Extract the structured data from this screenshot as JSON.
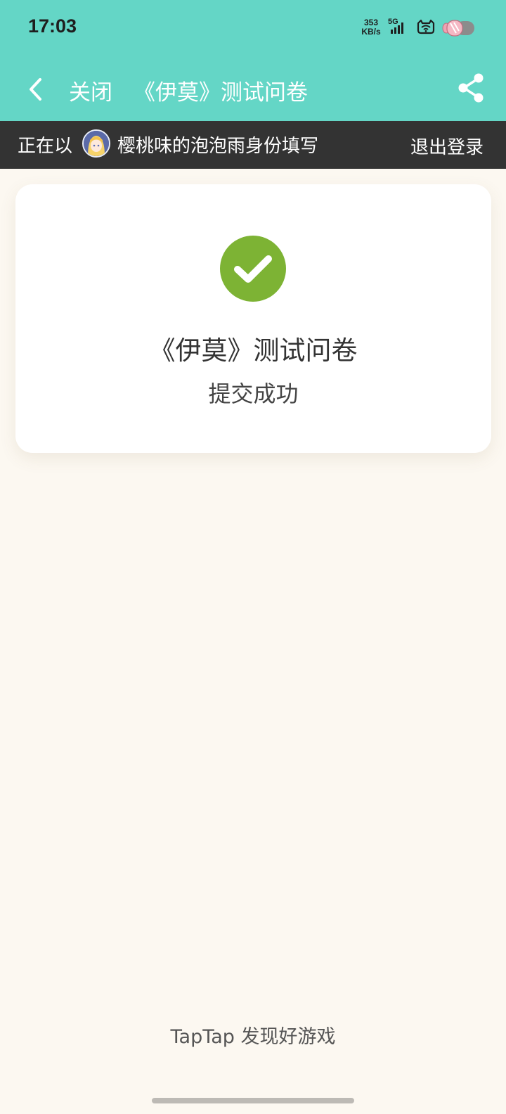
{
  "status_bar": {
    "time": "17:03",
    "net_speed_value": "353",
    "net_speed_unit": "KB/s",
    "network_type": "5G",
    "icons": [
      "signal-icon",
      "wifi-icon",
      "battery-icon"
    ]
  },
  "header": {
    "back_icon": "chevron-left-icon",
    "close_label": "关闭",
    "title": "《伊莫》测试问卷",
    "share_icon": "share-icon",
    "background_color": "#64d6c6"
  },
  "login_bar": {
    "prefix": "正在以",
    "username": "樱桃味的泡泡雨身份填写",
    "logout_label": "退出登录",
    "background_color": "#333333"
  },
  "result_card": {
    "icon": "check-circle-icon",
    "icon_color": "#7db334",
    "survey_name": "《伊莫》测试问卷",
    "status": "提交成功"
  },
  "footer": {
    "text": "TapTap 发现好游戏"
  }
}
